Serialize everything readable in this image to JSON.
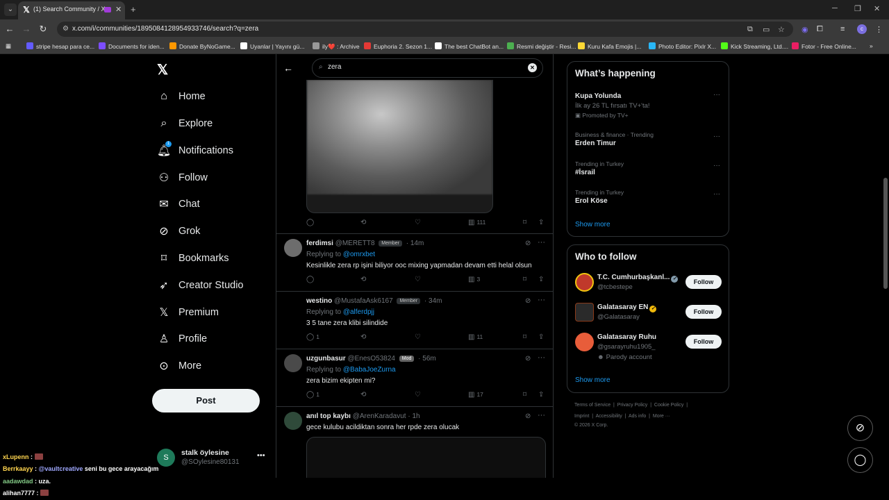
{
  "browser": {
    "tab_title": "(1) Search Community / X",
    "url": "x.com/i/communities/1895084128954933746/search?q=zera",
    "bookmarks": [
      {
        "label": "stripe hesap para ce...",
        "color": "#635bff"
      },
      {
        "label": "Documents for iden...",
        "color": "#7c4dff"
      },
      {
        "label": "Donate ByNoGame...",
        "color": "#ff9800"
      },
      {
        "label": "Uyanlar | Yayını gü...",
        "color": "#ffffff"
      },
      {
        "label": "ily❤️ : Archive",
        "color": "#999999"
      },
      {
        "label": "Euphoria 2. Sezon 1...",
        "color": "#e53935"
      },
      {
        "label": "The best ChatBot an...",
        "color": "#ffffff"
      },
      {
        "label": "Resmi değiştir - Resi...",
        "color": "#4caf50"
      },
      {
        "label": "Kuru Kafa Emojis |...",
        "color": "#fdd835"
      },
      {
        "label": "Photo Editor: Pixlr X...",
        "color": "#29b6f6"
      },
      {
        "label": "Kick Streaming, Ltd....",
        "color": "#53fc18"
      },
      {
        "label": "Fotor - Free Online...",
        "color": "#e91e63"
      }
    ]
  },
  "nav": {
    "items": [
      {
        "label": "Home",
        "icon": "home-icon"
      },
      {
        "label": "Explore",
        "icon": "search-icon"
      },
      {
        "label": "Notifications",
        "icon": "bell-icon",
        "badge": "1"
      },
      {
        "label": "Follow",
        "icon": "person-add-icon"
      },
      {
        "label": "Chat",
        "icon": "mail-icon"
      },
      {
        "label": "Grok",
        "icon": "grok-icon"
      },
      {
        "label": "Bookmarks",
        "icon": "bookmark-icon"
      },
      {
        "label": "Creator Studio",
        "icon": "rocket-icon"
      },
      {
        "label": "Premium",
        "icon": "x-logo-icon"
      },
      {
        "label": "Profile",
        "icon": "person-icon"
      },
      {
        "label": "More",
        "icon": "more-circle-icon"
      }
    ],
    "post_label": "Post",
    "account": {
      "initial": "S",
      "name": "stalk öylesine",
      "handle": "@SOylesine80131"
    }
  },
  "chat": [
    {
      "user": "xLupenn",
      "message": "",
      "user_color": "#ffd54f",
      "emote": true
    },
    {
      "user": "Berrkaayy",
      "message": "@vaultcreative seni bu gece arayacağım",
      "user_color": "#ffd54f",
      "mention": "@vaultcreative",
      "rest": " seni bu gece arayacağım"
    },
    {
      "user": "aadawdad",
      "message": "uza.",
      "user_color": "#81c784"
    },
    {
      "user": "alihan7777",
      "message": "",
      "user_color": "#ffffff",
      "emote": true
    }
  ],
  "search": {
    "query": "zera"
  },
  "tweets": [
    {
      "name": "ferdimsi",
      "handle": "@MERETT8",
      "badge": "Member",
      "time": "14m",
      "reply_prefix": "Replying to ",
      "reply_to": "@omrxbet",
      "text": "Kesinlikle zera rp işini biliyor ooc mixing yapmadan devam etti helal olsun",
      "replies": "",
      "views": "3"
    },
    {
      "name": "westino",
      "handle": "@MustafaAsk6167",
      "badge": "Member",
      "time": "34m",
      "reply_prefix": "Replying to ",
      "reply_to": "@alferdpjj",
      "text": "3 5 tane zera klibi silindide",
      "replies": "1",
      "views": "11"
    },
    {
      "name": "uzgunbasur",
      "handle": "@EnesO53824",
      "badge": "Mod",
      "time": "56m",
      "reply_prefix": "Replying to ",
      "reply_to": "@BabaJoeZurna",
      "text": "zera bizim ekipten mi?",
      "replies": "1",
      "views": "17"
    },
    {
      "name": "anıl top kaybı",
      "handle": "@ArenKaradavut",
      "badge": "",
      "time": "1h",
      "text": "gece kulubu acildiktan sonra her rpde zera olucak"
    }
  ],
  "first_tweet_views": "111",
  "happening": {
    "title": "What’s happening",
    "trends": [
      {
        "category": "",
        "name": "Kupa Yolunda",
        "sub": "İlk ay 26 TL fırsatı TV+'ta!",
        "promo": "Promoted by TV+"
      },
      {
        "category": "Business & finance · Trending",
        "name": "Erden Timur"
      },
      {
        "category": "Trending in Turkey",
        "name": "#İsrail"
      },
      {
        "category": "Trending in Turkey",
        "name": "Erol Köse"
      }
    ],
    "show_more": "Show more"
  },
  "who_to_follow": {
    "title": "Who to follow",
    "accounts": [
      {
        "name": "T.C. Cumhurbaşkanl...",
        "handle": "@tcbestepe",
        "verified": "#829aab",
        "avatar": "#c0392b"
      },
      {
        "name": "Galatasaray EN",
        "handle": "@Galatasaray",
        "verified": "#f0b90b",
        "avatar": "#2a2a2a"
      },
      {
        "name": "Galatasaray Ruhu",
        "handle": "@gsarayruhu1905_",
        "parody": "Parody account",
        "avatar": "#e85d3a"
      }
    ],
    "follow_label": "Follow",
    "show_more": "Show more"
  },
  "footer": {
    "line1": [
      "Terms of Service",
      "Privacy Policy",
      "Cookie Policy"
    ],
    "line2": [
      "Imprint",
      "Accessibility",
      "Ads info",
      "More ···"
    ],
    "copyright": "© 2026 X Corp."
  },
  "colors": {
    "accent": "#1d9bf0",
    "background": "#000000",
    "border": "#2f3336"
  }
}
